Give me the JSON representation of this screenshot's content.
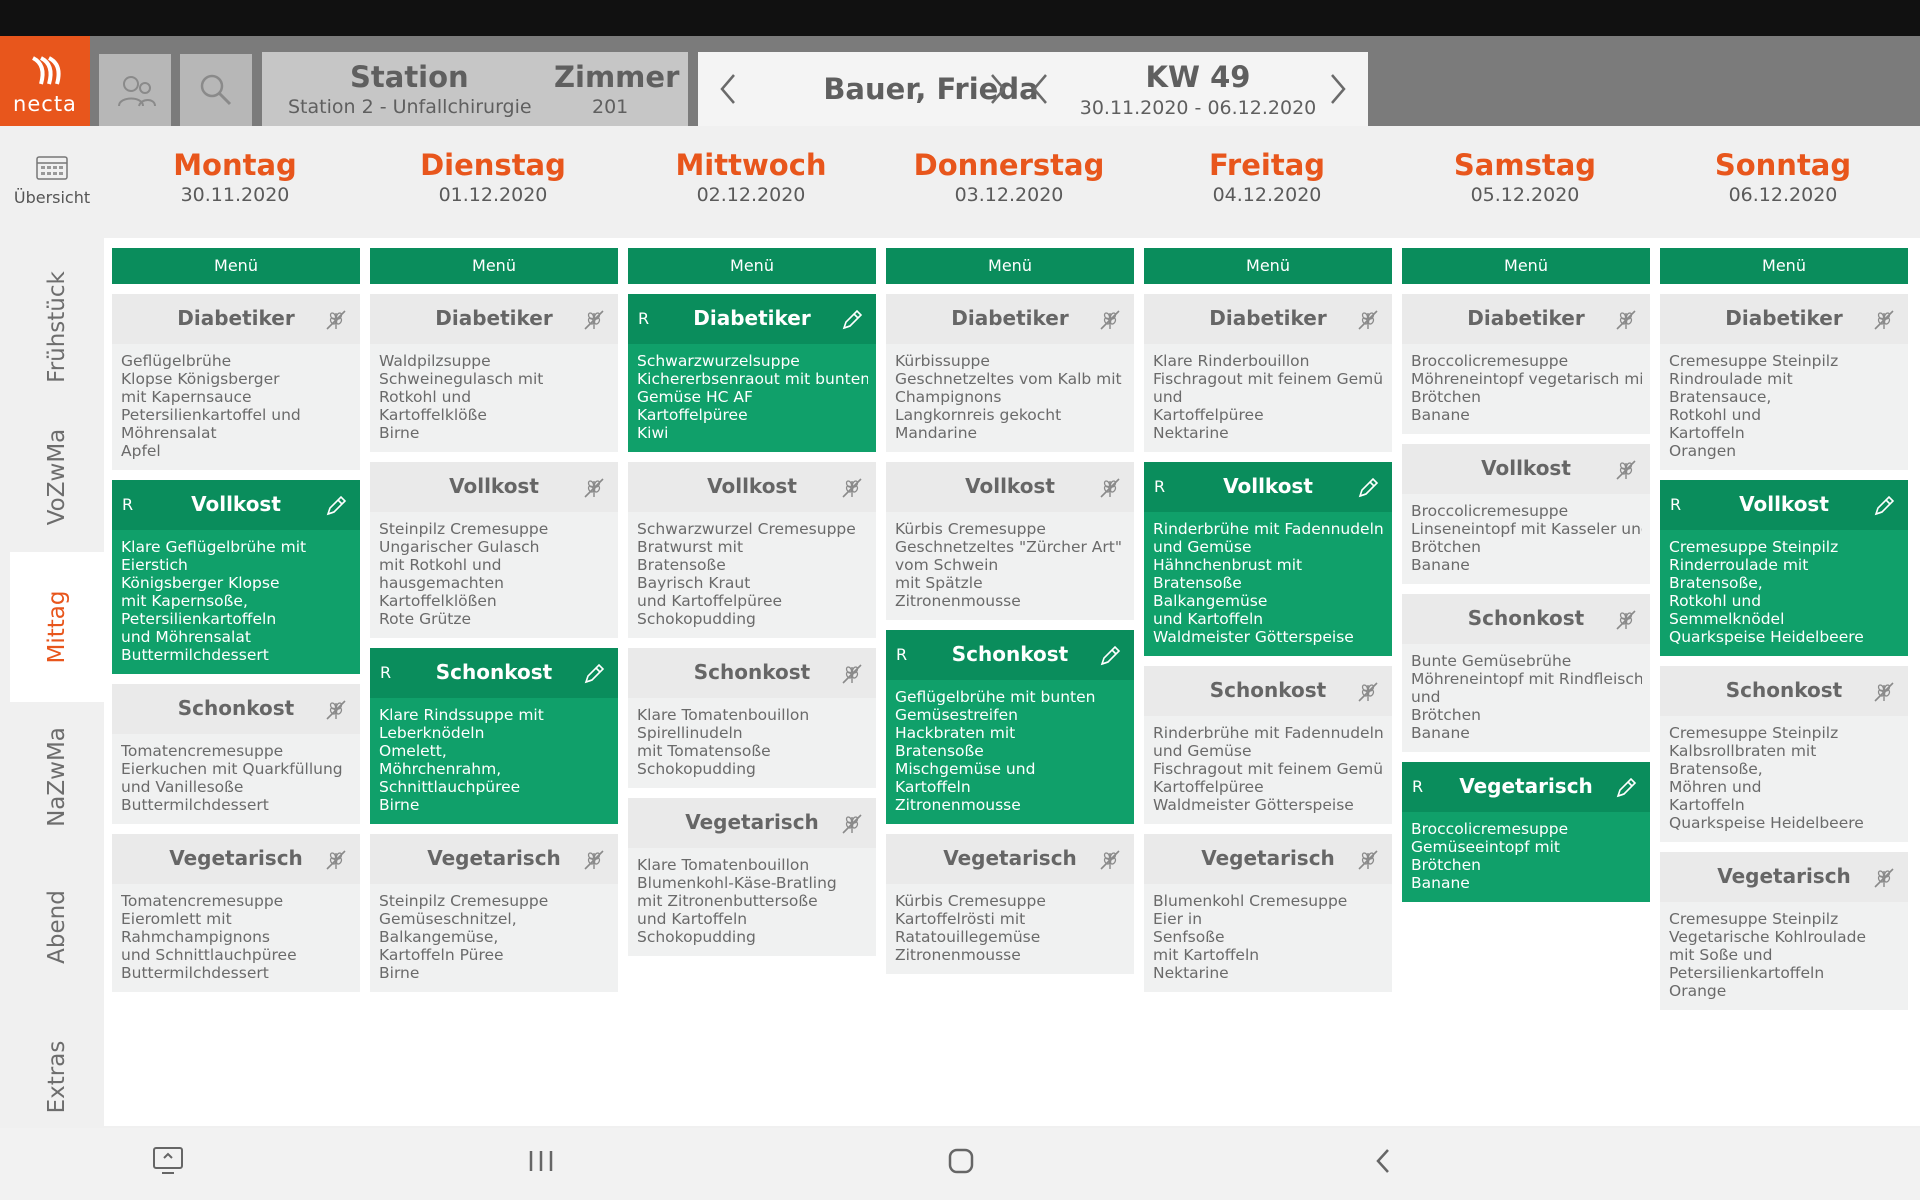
{
  "brand": {
    "logo_text": "necta",
    "accent": "#e8561c",
    "green": "#0a8d5c"
  },
  "header": {
    "station_label": "Station",
    "station_value": "Station 2 - Unfallchirurgie",
    "room_label": "Zimmer",
    "room_value": "201",
    "patient": "Bauer, Frieda",
    "week_label": "KW 49",
    "week_range": "30.11.2020 - 06.12.2020"
  },
  "overview_label": "Übersicht",
  "sidebar": {
    "items": [
      {
        "label": "Frühstück"
      },
      {
        "label": "VoZwMa"
      },
      {
        "label": "Mittag"
      },
      {
        "label": "NaZwMa"
      },
      {
        "label": "Abend"
      },
      {
        "label": "Extras"
      }
    ]
  },
  "menu_label": "Menü",
  "days": [
    {
      "name": "Montag",
      "date": "30.11.2020",
      "cards": [
        {
          "title": "Diabetiker",
          "lines": [
            "Geflügelbrühe",
            "Klopse Königsberger",
            "mit Kapernsauce",
            "Petersilienkartoffel und",
            "Möhrensalat",
            "Apfel"
          ]
        },
        {
          "title": "Vollkost",
          "selected": true,
          "lines": [
            "Klare Geflügelbrühe mit",
            "Eierstich",
            "Königsberger Klopse",
            "mit Kapernsoße,",
            "Petersilienkartoffeln",
            "und Möhrensalat",
            "Buttermilchdessert"
          ]
        },
        {
          "title": "Schonkost",
          "lines": [
            "Tomatencremesuppe",
            "Eierkuchen mit Quarkfüllung",
            "und Vanillesoße",
            "Buttermilchdessert"
          ]
        },
        {
          "title": "Vegetarisch",
          "lines": [
            "Tomatencremesuppe",
            "Eieromlett mit",
            "Rahmchampignons",
            "und Schnittlauchpüree",
            "Buttermilchdessert"
          ]
        }
      ]
    },
    {
      "name": "Dienstag",
      "date": "01.12.2020",
      "cards": [
        {
          "title": "Diabetiker",
          "lines": [
            "Waldpilzsuppe",
            "Schweinegulasch mit",
            "Rotkohl und",
            "Kartoffelklöße",
            "Birne"
          ]
        },
        {
          "title": "Vollkost",
          "lines": [
            "Steinpilz Cremesuppe",
            "Ungarischer Gulasch",
            "mit Rotkohl und",
            "hausgemachten",
            "Kartoffelklößen",
            "Rote Grütze"
          ]
        },
        {
          "title": "Schonkost",
          "selected": true,
          "lines": [
            "Klare Rindssuppe mit",
            "Leberknödeln",
            "Omelett,",
            "Möhrchenrahm,",
            "Schnittlauchpüree",
            "Birne"
          ]
        },
        {
          "title": "Vegetarisch",
          "lines": [
            "Steinpilz Cremesuppe",
            "Gemüseschnitzel,",
            "Balkangemüse,",
            "Kartoffeln Püree",
            "Birne"
          ]
        }
      ]
    },
    {
      "name": "Mittwoch",
      "date": "02.12.2020",
      "cards": [
        {
          "title": "Diabetiker",
          "selected": true,
          "lines": [
            "Schwarzwurzelsuppe",
            "Kichererbsenraout mit buntem",
            "Gemüse HC AF",
            "Kartoffelpüree",
            "Kiwi"
          ]
        },
        {
          "title": "Vollkost",
          "lines": [
            "Schwarzwurzel Cremesuppe",
            "Bratwurst mit",
            "Bratensoße",
            "Bayrisch Kraut",
            "und Kartoffelpüree",
            "Schokopudding"
          ]
        },
        {
          "title": "Schonkost",
          "lines": [
            "Klare Tomatenbouillon",
            "Spirellinudeln",
            "mit Tomatensoße",
            "Schokopudding"
          ]
        },
        {
          "title": "Vegetarisch",
          "lines": [
            "Klare Tomatenbouillon",
            "Blumenkohl-Käse-Bratling",
            "mit Zitronenbuttersoße",
            "und Kartoffeln",
            "Schokopudding"
          ]
        }
      ]
    },
    {
      "name": "Donnerstag",
      "date": "03.12.2020",
      "cards": [
        {
          "title": "Diabetiker",
          "lines": [
            "Kürbissuppe",
            "Geschnetzeltes vom Kalb mit",
            "Champignons",
            "Langkornreis gekocht",
            "Mandarine"
          ]
        },
        {
          "title": "Vollkost",
          "lines": [
            "Kürbis Cremesuppe",
            "Geschnetzeltes \"Zürcher Art\"",
            "vom Schwein",
            "mit Spätzle",
            "Zitronenmousse"
          ]
        },
        {
          "title": "Schonkost",
          "selected": true,
          "lines": [
            "Geflügelbrühe mit bunten",
            "Gemüsestreifen",
            "Hackbraten mit",
            "Bratensoße",
            "Mischgemüse und",
            "Kartoffeln",
            "Zitronenmousse"
          ]
        },
        {
          "title": "Vegetarisch",
          "lines": [
            "Kürbis Cremesuppe",
            "Kartoffelrösti mit",
            "Ratatouillegemüse",
            "Zitronenmousse"
          ]
        }
      ]
    },
    {
      "name": "Freitag",
      "date": "04.12.2020",
      "cards": [
        {
          "title": "Diabetiker",
          "lines": [
            "Klare Rinderbouillon",
            "Fischragout mit feinem Gemüse",
            "und",
            "Kartoffelpüree",
            "Nektarine"
          ]
        },
        {
          "title": "Vollkost",
          "selected": true,
          "lines": [
            "Rinderbrühe mit Fadennudeln",
            "und Gemüse",
            "Hähnchenbrust mit",
            "Bratensoße",
            "Balkangemüse",
            "und Kartoffeln",
            "Waldmeister Götterspeise"
          ]
        },
        {
          "title": "Schonkost",
          "lines": [
            "Rinderbrühe mit Fadennudeln",
            "und Gemüse",
            "Fischragout mit feinem Gemüse",
            "Kartoffelpüree",
            "Waldmeister Götterspeise"
          ]
        },
        {
          "title": "Vegetarisch",
          "lines": [
            "Blumenkohl Cremesuppe",
            "Eier in",
            "Senfsoße",
            "mit Kartoffeln",
            "Nektarine"
          ]
        }
      ]
    },
    {
      "name": "Samstag",
      "date": "05.12.2020",
      "cards": [
        {
          "title": "Diabetiker",
          "lines": [
            "Broccolicremesuppe",
            "Möhreneintopf vegetarisch mit",
            "Brötchen",
            "Banane"
          ]
        },
        {
          "title": "Vollkost",
          "lines": [
            "Broccolicremesuppe",
            "Linseneintopf mit Kasseler und",
            "Brötchen",
            "Banane"
          ]
        },
        {
          "title": "Schonkost",
          "lines": [
            "Bunte Gemüsebrühe",
            "Möhreneintopf mit Rindfleisch",
            "und",
            "Brötchen",
            "Banane"
          ]
        },
        {
          "title": "Vegetarisch",
          "selected": true,
          "lines": [
            "Broccolicremesuppe",
            "Gemüseeintopf mit",
            "Brötchen",
            "Banane"
          ]
        }
      ]
    },
    {
      "name": "Sonntag",
      "date": "06.12.2020",
      "cards": [
        {
          "title": "Diabetiker",
          "lines": [
            "Cremesuppe Steinpilz",
            "Rindroulade mit",
            "Bratensauce,",
            "Rotkohl und",
            "Kartoffeln",
            "Orangen"
          ]
        },
        {
          "title": "Vollkost",
          "selected": true,
          "lines": [
            "Cremesuppe Steinpilz",
            "Rinderroulade mit",
            "Bratensoße,",
            "Rotkohl und",
            "Semmelknödel",
            "Quarkspeise Heidelbeere"
          ]
        },
        {
          "title": "Schonkost",
          "lines": [
            "Cremesuppe Steinpilz",
            "Kalbsrollbraten mit",
            "Bratensoße,",
            "Möhren und",
            "Kartoffeln",
            "Quarkspeise Heidelbeere"
          ]
        },
        {
          "title": "Vegetarisch",
          "lines": [
            "Cremesuppe Steinpilz",
            "Vegetarische Kohlroulade",
            "mit Soße und",
            "Petersilienkartoffeln",
            "Orange"
          ]
        }
      ]
    }
  ],
  "selected_marker": "R"
}
